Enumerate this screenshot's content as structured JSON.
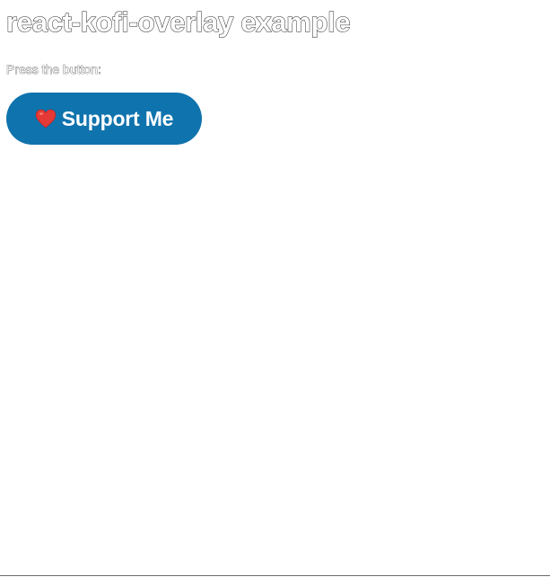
{
  "page": {
    "title": "react-kofi-overlay example",
    "prompt": "Press the button:"
  },
  "support_button": {
    "label": "Support Me",
    "icon": "heart-icon",
    "background": "#0f73ad"
  },
  "colors": {
    "heart": "#e53935"
  }
}
